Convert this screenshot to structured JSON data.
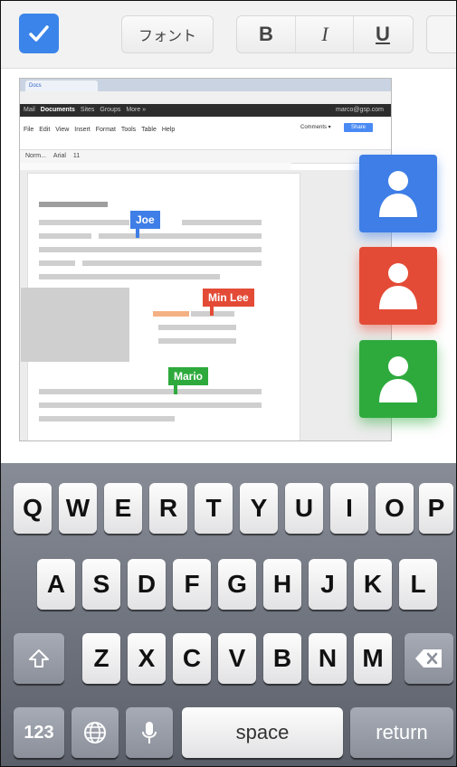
{
  "toolbar": {
    "font_label": "フォント",
    "bold_label": "B",
    "italic_label": "I",
    "underline_label": "U"
  },
  "browser": {
    "tab_label": "Docs",
    "google_bar": [
      "Mail",
      "Documents",
      "Sites",
      "Groups",
      "More »"
    ],
    "account_email": "marco@gsp.com",
    "menu": [
      "File",
      "Edit",
      "View",
      "Insert",
      "Format",
      "Tools",
      "Table",
      "Help"
    ],
    "toolbar_items": [
      "Norm...",
      "Arial",
      "11"
    ],
    "comments_label": "Comments ▾",
    "share_label": "Share"
  },
  "collaborators": [
    {
      "name": "Joe",
      "color": "#3e7ee6"
    },
    {
      "name": "Min Lee",
      "color": "#e34b36"
    },
    {
      "name": "Mario",
      "color": "#2eaa3d"
    }
  ],
  "keyboard": {
    "row1": [
      "Q",
      "W",
      "E",
      "R",
      "T",
      "Y",
      "U",
      "I",
      "O",
      "P"
    ],
    "row2": [
      "A",
      "S",
      "D",
      "F",
      "G",
      "H",
      "J",
      "K",
      "L"
    ],
    "row3": [
      "Z",
      "X",
      "C",
      "V",
      "B",
      "N",
      "M"
    ],
    "numbers_label": "123",
    "space_label": "space",
    "return_label": "return"
  }
}
